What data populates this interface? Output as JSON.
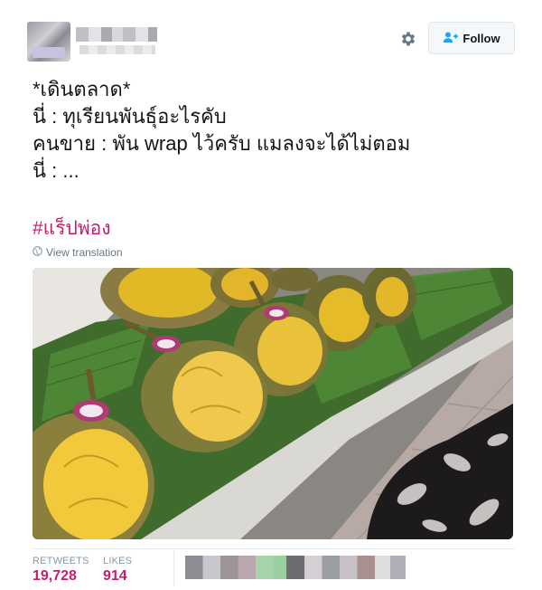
{
  "header": {
    "follow_label": "Follow"
  },
  "tweet": {
    "text": "*เดินตลาด*\nนี่ : ทุเรียนพันธุ์อะไรคับ\nคนขาย : พัน wrap ไว้ครับ แมลงจะได้ไม่ตอม\nนี่ : ...",
    "hashtag": "#แร็ปพ่อง",
    "translate_label": "View translation"
  },
  "stats": {
    "retweets_label": "RETWEETS",
    "retweets_value": "19,728",
    "likes_label": "LIKES",
    "likes_value": "914"
  },
  "colors": {
    "accent": "#c41e6b",
    "follow_icon": "#1da1f2"
  }
}
